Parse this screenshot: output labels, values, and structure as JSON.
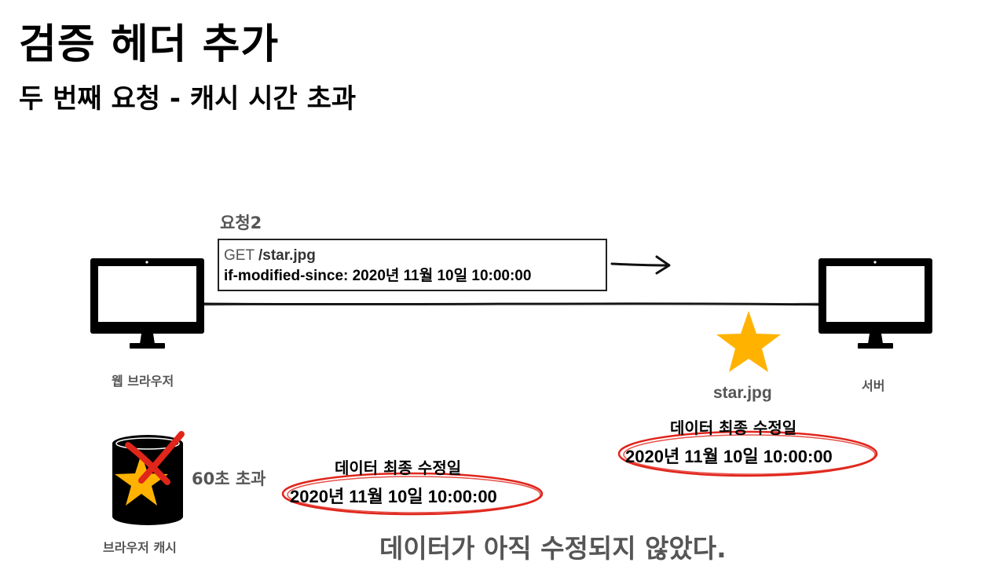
{
  "title": "검증 헤더 추가",
  "subtitle": "두 번째 요청 - 캐시 시간 초과",
  "request": {
    "label": "요청2",
    "method": "GET",
    "path": "/star.jpg",
    "header": "if-modified-since: 2020년 11월 10일 10:00:00"
  },
  "client": {
    "label": "웹 브라우저"
  },
  "server": {
    "label": "서버",
    "file_name": "star.jpg",
    "last_modified_caption": "데이터 최종 수정일",
    "last_modified_value": "2020년 11월 10일 10:00:00"
  },
  "cache": {
    "label": "브라우저 캐시",
    "expired_text": "60초 초과",
    "last_modified_caption": "데이터 최종 수정일",
    "last_modified_value": "2020년 11월 10일 10:00:00"
  },
  "conclusion": "데이터가 아직 수정되지 않았다.",
  "colors": {
    "star": "#FFB300",
    "ellipse": "#E0251B",
    "cross": "#E0251B",
    "muted_text": "#555555"
  },
  "icons": {
    "client": "monitor-icon",
    "server": "monitor-icon",
    "file": "star-icon",
    "cache": "cylinder-cache-icon",
    "invalidated": "cross-icon",
    "direction": "arrow-right-icon"
  }
}
